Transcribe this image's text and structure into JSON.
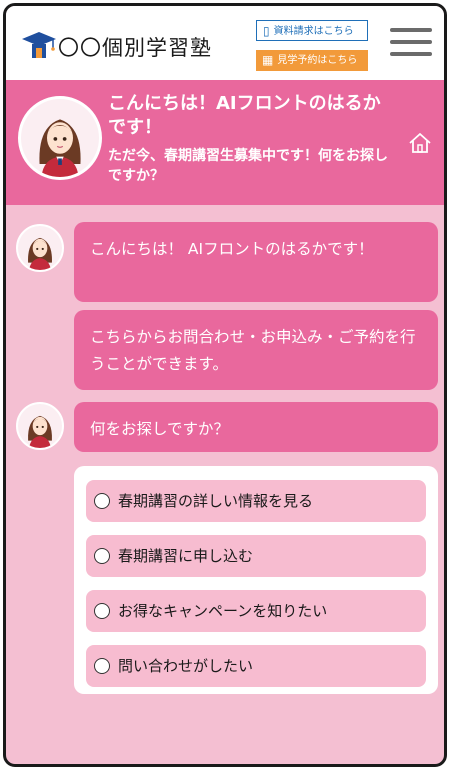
{
  "header": {
    "logo_icon": "school-building-icon",
    "logo_text": "〇〇個別学習塾",
    "doc_request_label": "資料請求はこちら",
    "visit_label": "見学予約はこちら",
    "menu_icon": "hamburger-menu-icon",
    "doc_color": "#1f6fb8",
    "visit_color": "#f29a3a"
  },
  "banner": {
    "greeting": "こんにちは！AIフロントのはるかです！",
    "subtext": "ただ今、春期講習生募集中です！何をお探しですか？",
    "home_icon": "home-icon",
    "color": "#e9689d"
  },
  "chat": {
    "messages": [
      "こんにちは！ AIフロントのはるかです！",
      "こちらからお問合わせ・お申込み・ご予約を行うことができます。",
      "何をお探しですか？"
    ]
  },
  "choices": [
    "春期講習の詳しい情報を見る",
    "春期講習に申し込む",
    "お得なキャンペーンを知りたい",
    "問い合わせがしたい"
  ]
}
